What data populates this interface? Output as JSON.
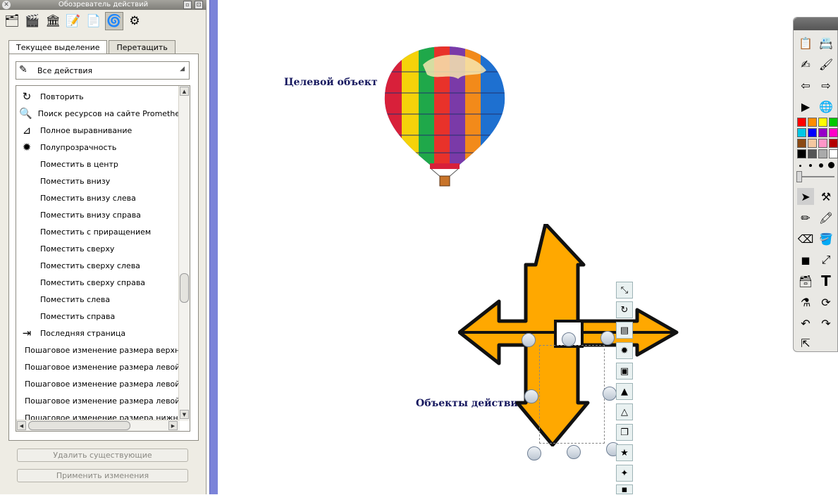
{
  "panel": {
    "title": "Обозреватель действий",
    "toolbar_icons": [
      "actions-page-icon",
      "media-icon",
      "resource-library-icon",
      "notes-icon",
      "page-properties-icon",
      "action-browser-icon",
      "object-tools-icon"
    ],
    "tabs": [
      {
        "label": "Текущее выделение",
        "active": true
      },
      {
        "label": "Перетащить",
        "active": false
      }
    ],
    "filter": {
      "value": "Все действия"
    },
    "items": [
      {
        "label": "Повторить",
        "icon": "redo-icon"
      },
      {
        "label": "Поиск ресурсов на сайте Promethean P",
        "icon": "search-globe-icon"
      },
      {
        "label": "Полное выравнивание",
        "icon": "align-icon"
      },
      {
        "label": "Полупрозрачность",
        "icon": "translucent-icon"
      },
      {
        "label": "Поместить в центр",
        "icon": ""
      },
      {
        "label": "Поместить внизу",
        "icon": ""
      },
      {
        "label": "Поместить внизу слева",
        "icon": ""
      },
      {
        "label": "Поместить внизу справа",
        "icon": ""
      },
      {
        "label": "Поместить с приращением",
        "icon": ""
      },
      {
        "label": "Поместить сверху",
        "icon": ""
      },
      {
        "label": "Поместить сверху слева",
        "icon": ""
      },
      {
        "label": "Поместить сверху справа",
        "icon": ""
      },
      {
        "label": "Поместить слева",
        "icon": ""
      },
      {
        "label": "Поместить справа",
        "icon": ""
      },
      {
        "label": "Последняя страница",
        "icon": "last-page-icon"
      },
      {
        "label": "Пошаговое изменение размера верхней",
        "icon": ""
      },
      {
        "label": "Пошаговое изменение размера левой в",
        "icon": ""
      },
      {
        "label": "Пошаговое изменение размера левой н",
        "icon": ""
      },
      {
        "label": "Пошаговое изменение размера левой ч",
        "icon": ""
      },
      {
        "label": "Пошаговое изменение размера нижней",
        "icon": ""
      }
    ],
    "delete_button": "Удалить существующие",
    "apply_button": "Применить изменения"
  },
  "canvas": {
    "target_label": "Целевой объект",
    "actions_label": "Объекты действия"
  },
  "colors": {
    "arrow_fill": "#ffa800",
    "label_color": "#15175e",
    "strip": "#7b83d9"
  },
  "toolbox": {
    "palette": [
      "#ff0000",
      "#ff8c00",
      "#ffff00",
      "#00c800",
      "#00c8e6",
      "#0000ff",
      "#9600c8",
      "#ff00c8",
      "#8b4a14",
      "#f5c8a0",
      "#ff96c8",
      "#b40000",
      "#000000",
      "#555555",
      "#aaaaaa",
      "#ffffff"
    ]
  }
}
